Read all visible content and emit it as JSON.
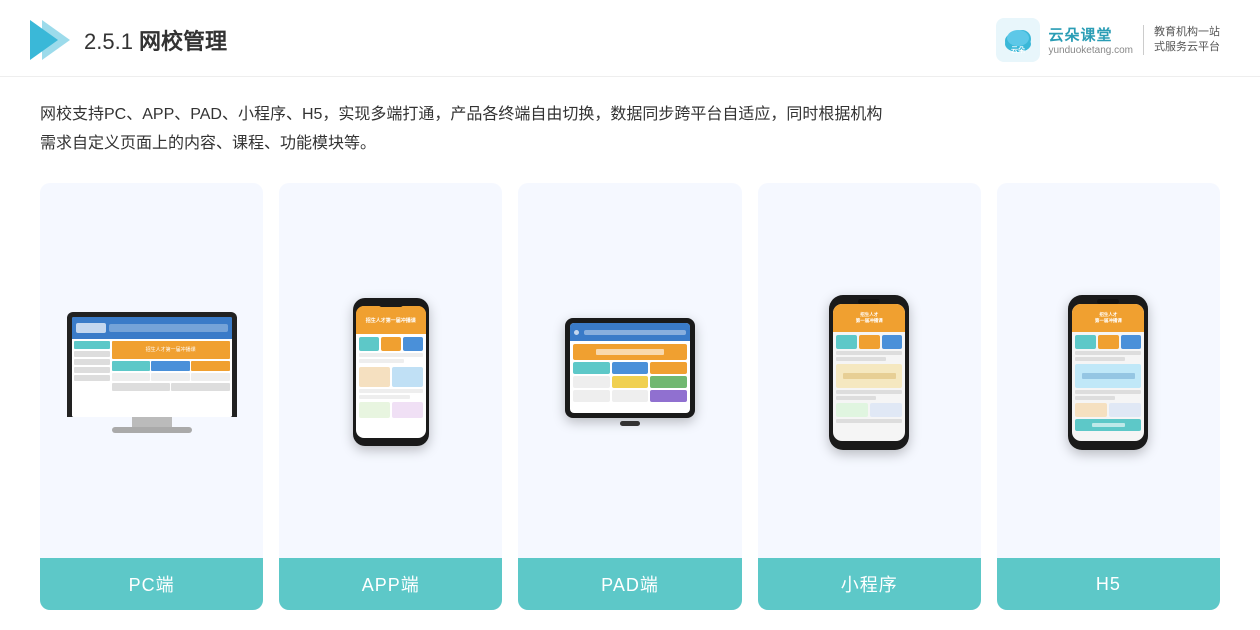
{
  "header": {
    "title_prefix": "2.5.1 ",
    "title_bold": "网校管理",
    "brand_name": "云朵课堂",
    "brand_url": "yunduoketang.com",
    "brand_slogan_line1": "教育机构一站",
    "brand_slogan_line2": "式服务云平台"
  },
  "description": {
    "line1": "网校支持PC、APP、PAD、小程序、H5，实现多端打通，产品各终端自由切换，数据同步跨平台自适应，同时根据机构",
    "line2": "需求自定义页面上的内容、课程、功能模块等。"
  },
  "cards": [
    {
      "id": "pc",
      "label": "PC端"
    },
    {
      "id": "app",
      "label": "APP端"
    },
    {
      "id": "pad",
      "label": "PAD端"
    },
    {
      "id": "miniprogram",
      "label": "小程序"
    },
    {
      "id": "h5",
      "label": "H5"
    }
  ]
}
